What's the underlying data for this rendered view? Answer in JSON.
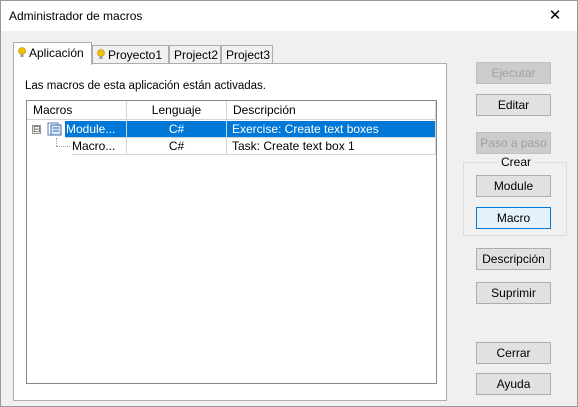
{
  "window": {
    "title": "Administrador de macros",
    "close_glyph": "✕"
  },
  "tabs": [
    {
      "label": "Aplicación",
      "icon": "lightbulb-icon",
      "active": true
    },
    {
      "label": "Proyecto1",
      "icon": "lightbulb-icon",
      "active": false
    },
    {
      "label": "Project2",
      "active": false
    },
    {
      "label": "Project3",
      "active": false
    }
  ],
  "panel": {
    "status_text": "Las macros de esta aplicación están activadas."
  },
  "grid": {
    "columns": [
      "Macros",
      "Lenguaje",
      "Descripción"
    ],
    "rows": [
      {
        "name": "Module...",
        "language": "C#",
        "description": "Exercise: Create text boxes",
        "selected": true,
        "expander": "⊟",
        "icon": "module-icon"
      },
      {
        "name": "Macro...",
        "language": "C#",
        "description": "Task: Create text box 1",
        "selected": false
      }
    ]
  },
  "buttons": {
    "run": "Ejecutar",
    "edit": "Editar",
    "step": "Paso a paso",
    "create_group_label": "Crear",
    "module": "Module",
    "macro": "Macro",
    "description": "Descripción",
    "delete": "Suprimir",
    "close": "Cerrar",
    "help": "Ayuda"
  },
  "colors": {
    "selection": "#0078d7",
    "disabled_text": "#a0a0a0",
    "lightbulb": "#f2c200"
  }
}
